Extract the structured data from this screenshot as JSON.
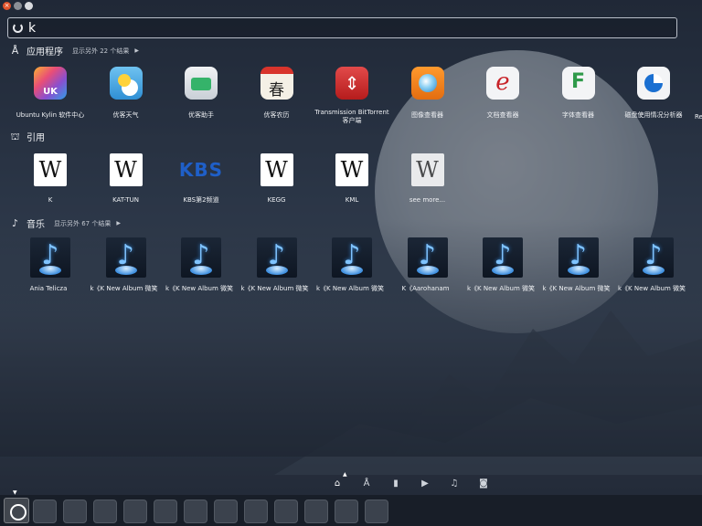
{
  "search": {
    "query": "k"
  },
  "sections": {
    "applications": {
      "title": "应用程序",
      "more": "显示另外 22 个结果"
    },
    "references": {
      "title": "引用"
    },
    "music": {
      "title": "音乐",
      "more": "显示另外 67 个结果"
    }
  },
  "apps": [
    {
      "name": "Ubuntu Kylin 软件中心",
      "icon": "ubuntu-kylin-store-icon"
    },
    {
      "name": "优客天气",
      "icon": "weather-icon"
    },
    {
      "name": "优客助手",
      "icon": "assistant-icon"
    },
    {
      "name": "优客农历",
      "icon": "calendar-icon"
    },
    {
      "name": "Transmission BitTorrent 客户端",
      "icon": "transmission-icon"
    },
    {
      "name": "图像查看器",
      "icon": "image-viewer-icon"
    },
    {
      "name": "文档查看器",
      "icon": "document-viewer-icon"
    },
    {
      "name": "字体查看器",
      "icon": "font-viewer-icon"
    },
    {
      "name": "磁盘使用情况分析器",
      "icon": "disk-usage-icon"
    }
  ],
  "apps_overflow_label": "Re",
  "references_items": [
    {
      "name": "K",
      "icon": "wikipedia-icon"
    },
    {
      "name": "KAT-TUN",
      "icon": "wikipedia-icon"
    },
    {
      "name": "KBS第2频道",
      "icon": "kbs-logo-icon"
    },
    {
      "name": "KEGG",
      "icon": "wikipedia-icon"
    },
    {
      "name": "KML",
      "icon": "wikipedia-icon"
    },
    {
      "name": "see more...",
      "icon": "wikipedia-icon"
    }
  ],
  "kbs_logo_text": "KBS",
  "wiki_glyph": "W",
  "music_items": [
    {
      "name": "Ania Telicza"
    },
    {
      "name": "k《K New Album 微笑"
    },
    {
      "name": "k《K New Album 微笑"
    },
    {
      "name": "k《K New Album 微笑"
    },
    {
      "name": "k《K New Album 微笑"
    },
    {
      "name": "K《Aarohanam"
    },
    {
      "name": "k《K New Album 微笑"
    },
    {
      "name": "k《K New Album 微笑"
    },
    {
      "name": "k《K New Album 微笑"
    }
  ],
  "filters": [
    "home-icon",
    "applications-icon",
    "files-icon",
    "video-icon",
    "music-icon",
    "photo-icon"
  ],
  "colors": {
    "accent_close": "#e2532b",
    "kbs_blue": "#1f5fc8"
  }
}
